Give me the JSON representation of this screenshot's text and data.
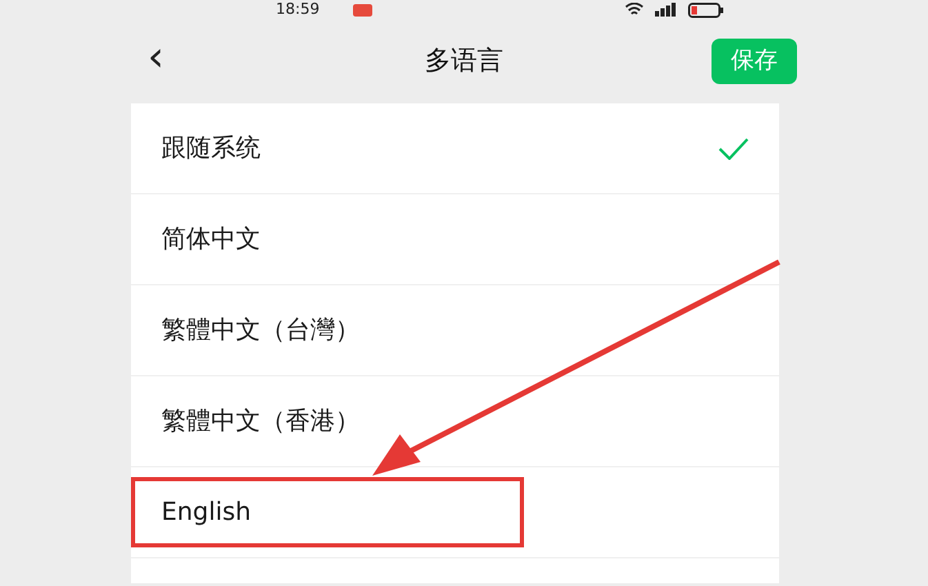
{
  "status_bar": {
    "time": "18:59"
  },
  "nav": {
    "back": "‹",
    "title": "多语言",
    "save": "保存"
  },
  "languages": [
    {
      "label": "跟随系统",
      "selected": true,
      "highlighted": false
    },
    {
      "label": "简体中文",
      "selected": false,
      "highlighted": false
    },
    {
      "label": "繁體中文（台灣）",
      "selected": false,
      "highlighted": false
    },
    {
      "label": "繁體中文（香港）",
      "selected": false,
      "highlighted": false
    },
    {
      "label": "English",
      "selected": false,
      "highlighted": true
    }
  ]
}
